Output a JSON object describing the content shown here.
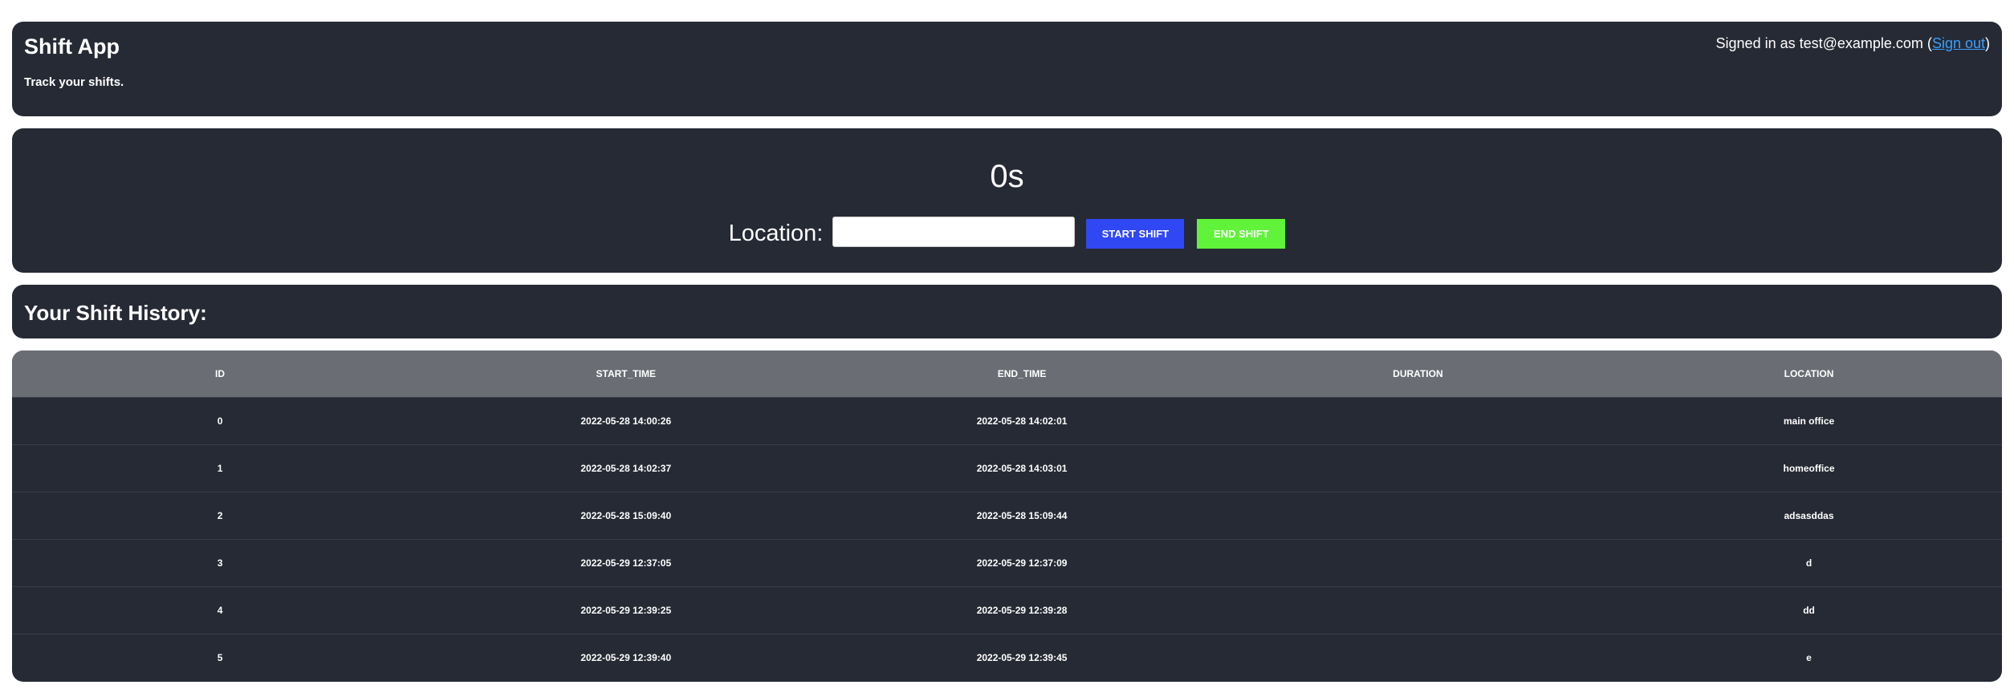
{
  "header": {
    "title": "Shift App",
    "subtitle": "Track your shifts.",
    "signed_in_prefix": "Signed in as test@example.com (",
    "sign_out_label": "Sign out",
    "signed_in_suffix": ")"
  },
  "timer": {
    "value": "0s",
    "location_label": "Location:",
    "location_value": "",
    "start_label": "START SHIFT",
    "end_label": "END SHIFT"
  },
  "history": {
    "title": "Your Shift History:"
  },
  "colors": {
    "card_bg": "#262a34",
    "table_header_bg": "#6a6e74",
    "start_button": "#3048f4",
    "end_button": "#61f23a",
    "link": "#3aa0ff"
  },
  "table": {
    "columns": [
      "ID",
      "START_TIME",
      "END_TIME",
      "DURATION",
      "LOCATION"
    ],
    "rows": [
      [
        "0",
        "2022-05-28 14:00:26",
        "2022-05-28 14:02:01",
        "",
        "main office"
      ],
      [
        "1",
        "2022-05-28 14:02:37",
        "2022-05-28 14:03:01",
        "",
        "homeoffice"
      ],
      [
        "2",
        "2022-05-28 15:09:40",
        "2022-05-28 15:09:44",
        "",
        "adsasddas"
      ],
      [
        "3",
        "2022-05-29 12:37:05",
        "2022-05-29 12:37:09",
        "",
        "d"
      ],
      [
        "4",
        "2022-05-29 12:39:25",
        "2022-05-29 12:39:28",
        "",
        "dd"
      ],
      [
        "5",
        "2022-05-29 12:39:40",
        "2022-05-29 12:39:45",
        "",
        "e"
      ]
    ]
  }
}
